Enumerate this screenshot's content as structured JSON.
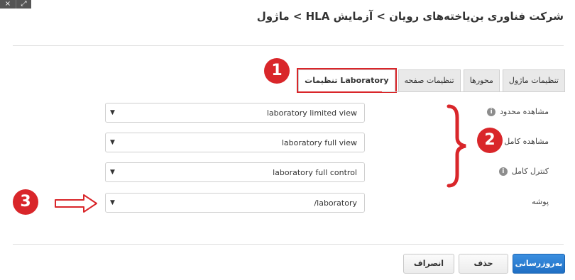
{
  "window_controls": {
    "close": "×",
    "expand": "⤢"
  },
  "header": {
    "title": "شرکت فناوری بن‌یاخته‌های رویان > آزمایش HLA > ماژول"
  },
  "tabs": [
    {
      "label": "تنظیمات ماژول"
    },
    {
      "label": "محورها"
    },
    {
      "label": "تنظیمات صفحه"
    },
    {
      "label": "Laboratory تنظیمات",
      "active": true
    }
  ],
  "fields": [
    {
      "label": "مشاهده محدود",
      "info": "i",
      "value": "laboratory limited view"
    },
    {
      "label": "مشاهده کامل",
      "info": "i",
      "value": "laboratory full view"
    },
    {
      "label": "کنترل کامل",
      "info": "i",
      "value": "laboratory full control"
    },
    {
      "label": "پوشه",
      "value": "/laboratory"
    }
  ],
  "buttons": {
    "refresh": "به‌روزرسانی",
    "delete": "حذف",
    "cancel": "انصراف"
  },
  "annotations": {
    "badge1": "1",
    "badge2": "2",
    "badge3": "3",
    "color": "#d9262a"
  },
  "colors": {
    "primary": "#1f6fc4",
    "annotation": "#d9262a"
  }
}
